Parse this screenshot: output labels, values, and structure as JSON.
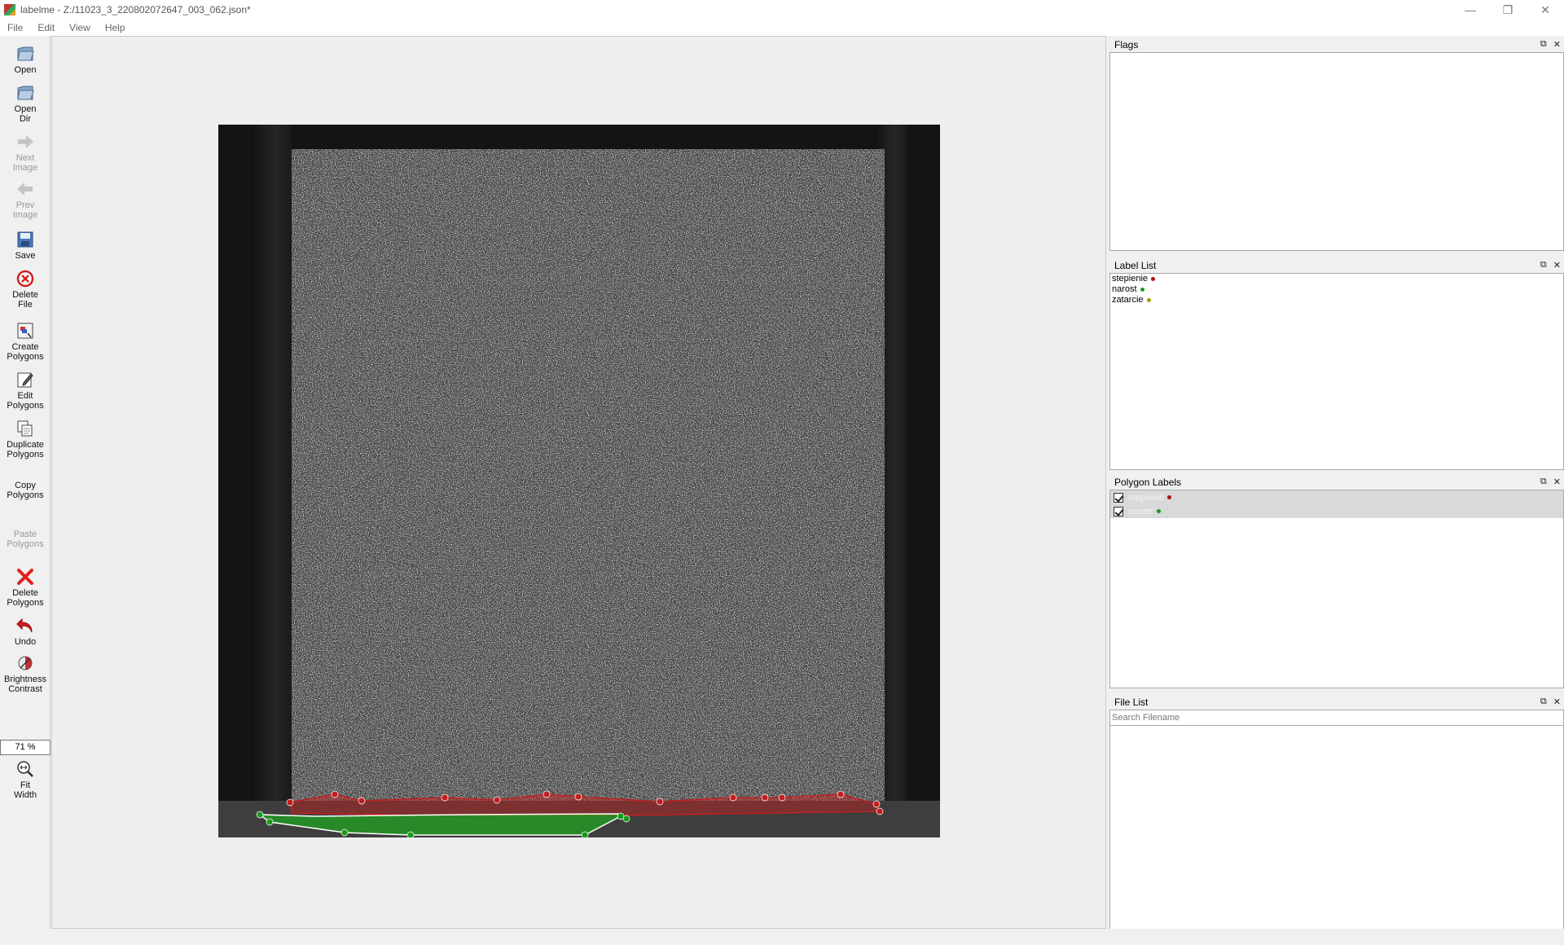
{
  "window": {
    "title": "labelme - Z:/11023_3_220802072647_003_062.json*",
    "controls": {
      "minimize": "—",
      "restore": "❐",
      "close": "✕"
    }
  },
  "menu": [
    "File",
    "Edit",
    "View",
    "Help"
  ],
  "toolbar": {
    "open": "Open",
    "open_dir": "Open\nDir",
    "next_image": "Next\nImage",
    "prev_image": "Prev\nImage",
    "save": "Save",
    "delete_file": "Delete\nFile",
    "create_polygons": "Create\nPolygons",
    "edit_polygons": "Edit\nPolygons",
    "duplicate_polygons": "Duplicate\nPolygons",
    "copy_polygons": "Copy\nPolygons",
    "paste_polygons": "Paste\nPolygons",
    "delete_polygons": "Delete\nPolygons",
    "undo": "Undo",
    "brightness_contrast": "Brightness\nContrast",
    "zoom": "71 %",
    "fit_width": "Fit\nWidth"
  },
  "docks": {
    "flags": {
      "title": "Flags"
    },
    "label_list": {
      "title": "Label List",
      "items": [
        {
          "label": "stepienie",
          "color": "#b01010"
        },
        {
          "label": "narost",
          "color": "#1a9a1a"
        },
        {
          "label": "zatarcie",
          "color": "#a0a000"
        }
      ]
    },
    "polygon_labels": {
      "title": "Polygon Labels",
      "items": [
        {
          "label": "stepienie",
          "color": "#b01010",
          "checked": true
        },
        {
          "label": "narost",
          "color": "#1a9a1a",
          "checked": true
        }
      ]
    },
    "file_list": {
      "title": "File List",
      "search_placeholder": "Search Filename"
    },
    "dock_ctrl_float": "⧉",
    "dock_ctrl_close": "✕"
  },
  "annotations": {
    "stepienie_color": "#c02020",
    "narost_color": "#20a020"
  }
}
